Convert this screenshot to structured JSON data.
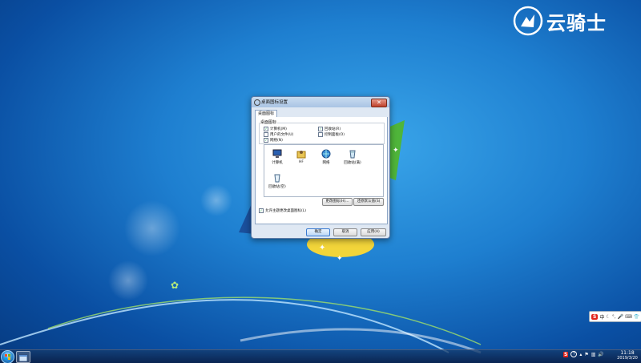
{
  "watermark": {
    "text": "云骑士"
  },
  "dialog": {
    "title": "桌面图标设置",
    "tab": "桌面图标",
    "group_title": "桌面图标",
    "checkboxes": [
      {
        "label": "计算机(M)",
        "checked": true
      },
      {
        "label": "回收站(R)",
        "checked": true
      },
      {
        "label": "用户的文件(U)",
        "checked": false
      },
      {
        "label": "控制面板(O)",
        "checked": false
      },
      {
        "label": "网络(N)",
        "checked": true
      }
    ],
    "icons": [
      {
        "label": "计算机",
        "icon": "computer-icon"
      },
      {
        "label": "HF",
        "icon": "user-folder-icon"
      },
      {
        "label": "网络",
        "icon": "network-icon"
      },
      {
        "label": "回收站(满)",
        "icon": "recycle-bin-full-icon"
      },
      {
        "label": "回收站(空)",
        "icon": "recycle-bin-empty-icon"
      }
    ],
    "change_icon_button": "更改图标(H)...",
    "restore_default_button": "还原默认值(S)",
    "allow_themes_label": "允许主题更改桌面图标(L)",
    "allow_themes_checked": true,
    "ok_button": "确定",
    "cancel_button": "取消",
    "apply_button": "应用(A)"
  },
  "ime": {
    "logo": "S",
    "mode": "中"
  },
  "tray": {
    "s_logo": "S",
    "help": "?"
  },
  "clock": {
    "time": "11:18",
    "date": "2019/3/20"
  },
  "colors": {
    "accent": "#1e7fd0",
    "sogou_red": "#e2231a"
  }
}
